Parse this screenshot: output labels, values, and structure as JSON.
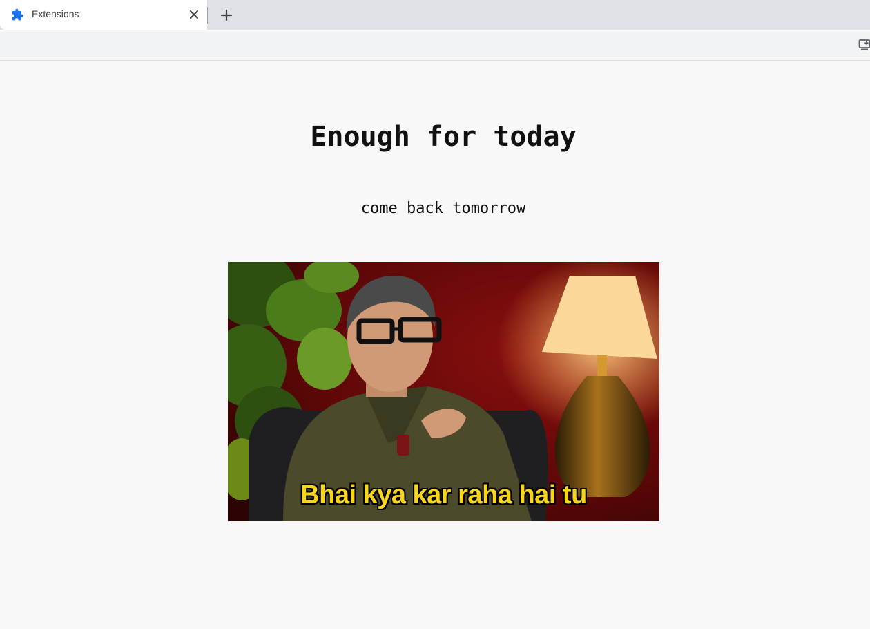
{
  "browser": {
    "tab_title": "Extensions",
    "tab_icon": "puzzle-icon",
    "close_icon": "close-icon",
    "new_tab_icon": "plus-icon",
    "install_icon": "install-app-icon",
    "accent_color": "#1a73e8"
  },
  "page": {
    "heading": "Enough for today",
    "subheading": "come back tomorrow",
    "meme_caption": "Bhai kya kar raha hai tu"
  }
}
